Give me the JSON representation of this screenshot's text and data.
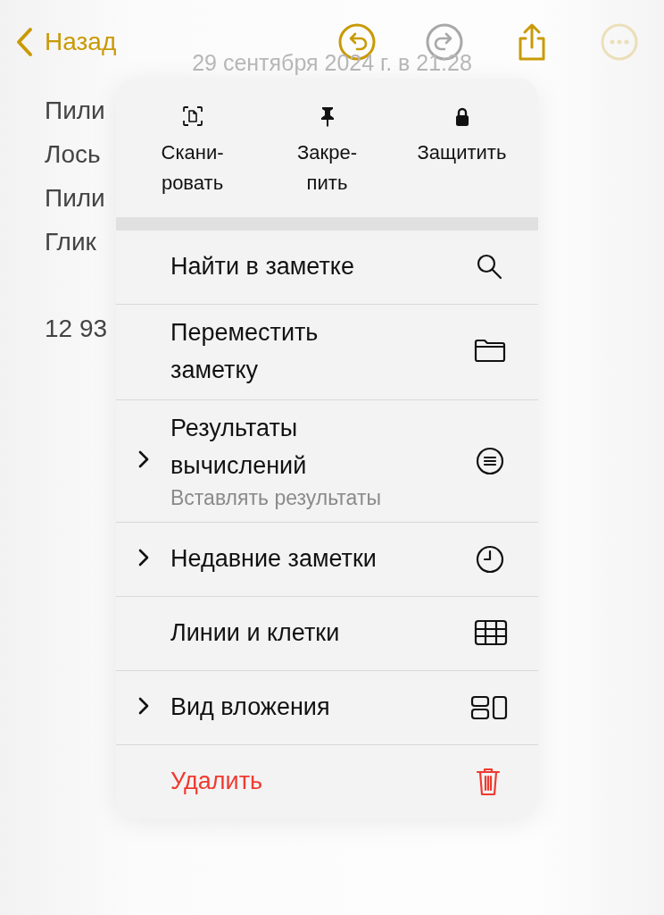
{
  "toolbar": {
    "back": {
      "label": "Назад"
    },
    "buttons": [
      {
        "disabled": false,
        "dimmed": false
      },
      {
        "disabled": true,
        "dimmed": false
      },
      {
        "disabled": false,
        "dimmed": false
      },
      {
        "disabled": false,
        "dimmed": true
      }
    ]
  },
  "note": {
    "date": "29 сентября 2024 г. в 21:28",
    "lines": [
      {
        "text": "Пили"
      },
      {
        "text": "Лось"
      },
      {
        "text": "Пили"
      },
      {
        "text": "Глик"
      },
      {
        "text": "12 93"
      }
    ]
  },
  "menu": {
    "actions": [
      {
        "label": "Скани-\nровать"
      },
      {
        "label": "Закре-\nпить"
      },
      {
        "label": "Защитить"
      }
    ],
    "items": [
      {
        "label": "Найти в заметке",
        "submenu": false,
        "kind": "normal"
      },
      {
        "label": "Переместить\nзаметку",
        "submenu": false,
        "kind": "normal"
      },
      {
        "label": "Результаты\nвычислений",
        "subtitle": "Вставлять результаты",
        "submenu": true,
        "kind": "normal"
      },
      {
        "label": "Недавние заметки",
        "submenu": true,
        "kind": "normal"
      },
      {
        "label": "Линии и клетки",
        "submenu": false,
        "kind": "normal"
      },
      {
        "label": "Вид вложения",
        "submenu": true,
        "kind": "normal"
      },
      {
        "label": "Удалить",
        "submenu": false,
        "kind": "destructive"
      }
    ]
  }
}
